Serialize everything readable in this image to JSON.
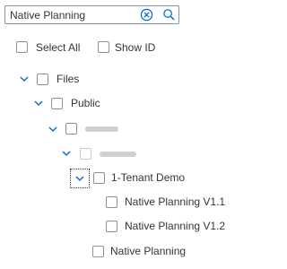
{
  "search": {
    "value": "Native Planning",
    "clear_icon": "clear-circle-icon",
    "search_icon": "search-icon"
  },
  "options": {
    "select_all": "Select All",
    "show_id": "Show ID"
  },
  "tree": {
    "files": "Files",
    "public": "Public",
    "tenant_demo": "1-Tenant Demo",
    "npv11": "Native Planning V1.1",
    "npv12": "Native Planning V1.2",
    "native_planning": "Native Planning"
  },
  "colors": {
    "border": "#89919a",
    "text": "#32363a",
    "icon": "#0a6ed1"
  }
}
